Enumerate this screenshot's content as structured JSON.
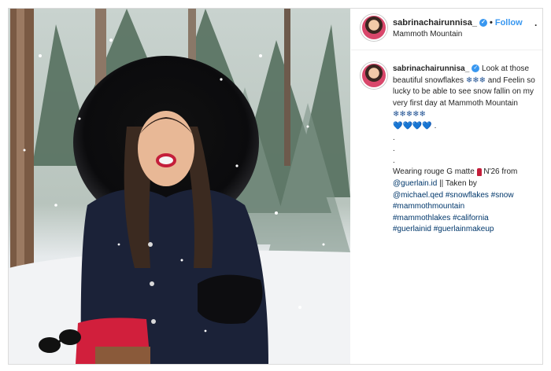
{
  "post": {
    "username": "sabrinachairunnisa_",
    "verified_icon": "verified-badge-icon",
    "separator": "•",
    "follow_label": "Follow",
    "location": "Mammoth Mountain",
    "more_icon": "more-options-icon",
    "more_glyph": "·"
  },
  "caption": {
    "username": "sabrinachairunnisa_",
    "line1": "Look at those beautiful snowflakes",
    "snow_emoji": "❄❄❄",
    "line2": "and Feelin so lucky to be able to see snow fallin on my very first day at Mammoth Mountain",
    "snow_emoji2": "❄❄❄❄❄",
    "hearts": "💙💙💙💙",
    "hearts_end": ".",
    "dots": [
      ".",
      ".",
      "."
    ],
    "wear_text": "Wearing rouge G matte",
    "lipstick_icon": "lipstick-icon",
    "shade": "N'26 from",
    "mention1": "@guerlain.id",
    "taken_by": "|| Taken by",
    "mention2": "@michael.qed",
    "tags": [
      "#snowflakes",
      "#snow",
      "#mammothmountain",
      "#mammothlakes",
      "#california",
      "#guerlainid",
      "#guerlainmakeup"
    ]
  },
  "colors": {
    "link": "#00376b",
    "follow": "#3897f0",
    "coat": "#1b2238",
    "bag": "#d11f3c"
  }
}
